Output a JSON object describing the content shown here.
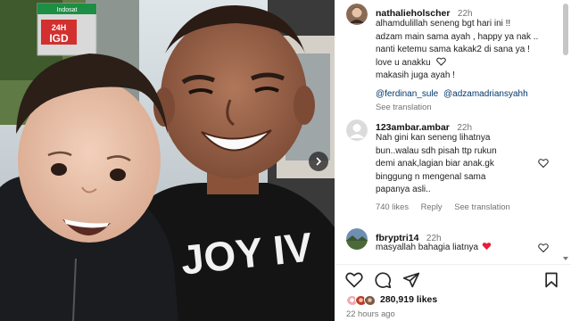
{
  "photo": {
    "signs": [
      "Indosat",
      "24H",
      "IGD"
    ],
    "shirt_text": "JOY IV"
  },
  "post": {
    "author": "nathalieholscher",
    "time": "22h",
    "caption_lines": [
      "alhamdulillah seneng bgt hari ini !!",
      "adzam main sama ayah , happy ya nak ..",
      "nanti ketemu sama kakak2 di sana ya !",
      "love u anakku"
    ],
    "caption_line5": "makasih juga ayah !",
    "mention1": "@ferdinan_sule",
    "mention2": "@adzamadriansyahh",
    "see_translation": "See translation"
  },
  "comments": [
    {
      "user": "123ambar.ambar",
      "time": "22h",
      "lines": [
        "Nah gini kan seneng lihatnya",
        "bun..walau sdh pisah ttp rukun",
        "demi anak,lagian biar anak.gk",
        "binggung n mengenal sama",
        "papanya asli.."
      ],
      "likes": "740 likes",
      "reply": "Reply",
      "translate": "See translation"
    },
    {
      "user": "fbryptri14",
      "time": "22h",
      "text": "masyallah bahagia liatnya"
    }
  ],
  "icons": {
    "like": "heart-icon",
    "comment": "comment-icon",
    "share": "send-icon",
    "save": "bookmark-icon",
    "next": "chevron-right-icon"
  },
  "likes_count": "280,919 likes",
  "posted": "22 hours ago",
  "colors": {
    "link": "#00376b",
    "meta": "#737373",
    "heart_red": "#ed1a3b"
  }
}
